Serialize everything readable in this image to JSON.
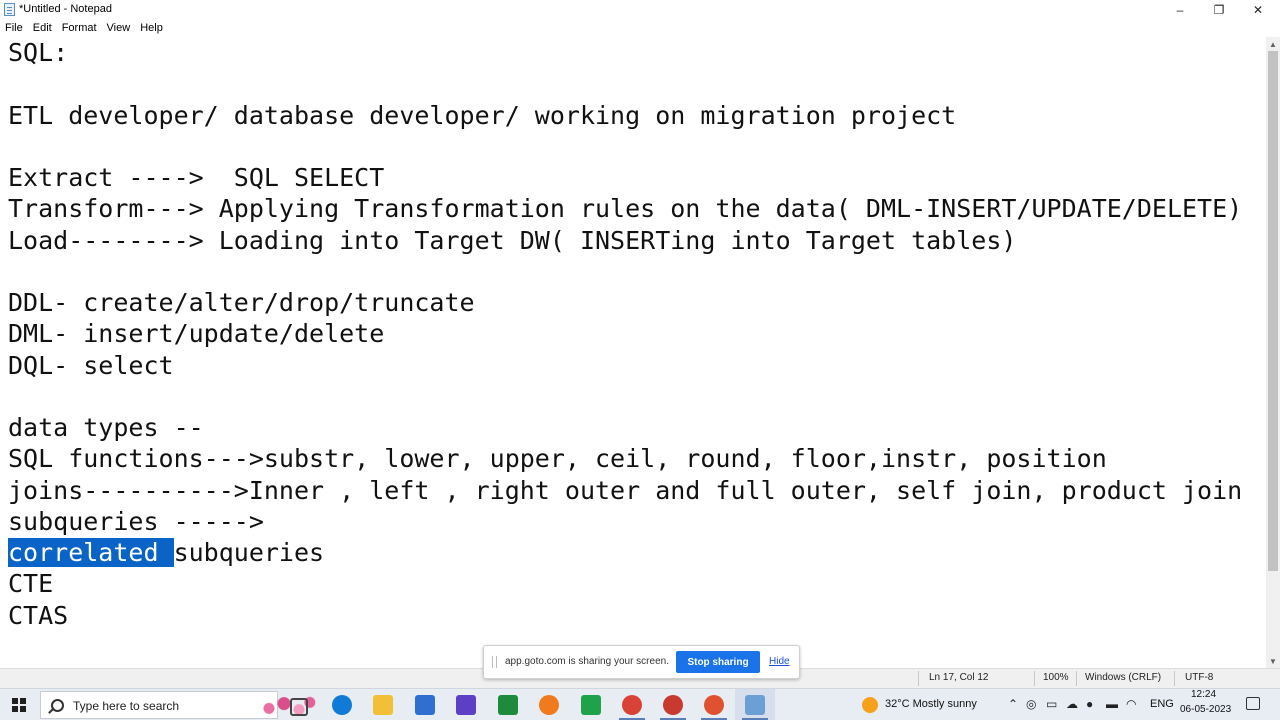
{
  "window": {
    "title": "*Untitled - Notepad",
    "controls": {
      "minimize": "–",
      "maximize": "❐",
      "close": "✕"
    }
  },
  "menu": [
    "File",
    "Edit",
    "Format",
    "View",
    "Help"
  ],
  "document": {
    "lines": [
      "SQL:",
      "",
      "ETL developer/ database developer/ working on migration project",
      "",
      "Extract ---->  SQL SELECT",
      "Transform---> Applying Transformation rules on the data( DML-INSERT/UPDATE/DELETE)",
      "Load--------> Loading into Target DW( INSERTing into Target tables)",
      "",
      "DDL- create/alter/drop/truncate",
      "DML- insert/update/delete",
      "DQL- select",
      "",
      "data types --",
      "SQL functions--->substr, lower, upper, ceil, round, floor,instr, position",
      "joins---------->Inner , left , right outer and full outer, self join, product join",
      "subqueries ----->"
    ],
    "selected_text": "correlated ",
    "after_selection": "subqueries",
    "lines_after": [
      "CTE",
      "CTAS"
    ]
  },
  "status_bar": {
    "position": "Ln 17, Col 12",
    "zoom": "100%",
    "line_ending": "Windows (CRLF)",
    "encoding": "UTF-8"
  },
  "share_banner": {
    "message": "app.goto.com is sharing your screen.",
    "stop_label": "Stop sharing",
    "hide_label": "Hide"
  },
  "taskbar": {
    "search_placeholder": "Type here to search",
    "weather": "32°C  Mostly sunny",
    "language": "ENG",
    "time": "12:24",
    "date": "06-05-2023",
    "apps": [
      {
        "icon": "task-view-icon",
        "color": "#444444"
      },
      {
        "icon": "edge-icon",
        "color": "#0f7bd6"
      },
      {
        "icon": "file-explorer-icon",
        "color": "#f2c037"
      },
      {
        "icon": "mail-icon",
        "color": "#2f6fd0"
      },
      {
        "icon": "visual-studio-icon",
        "color": "#5c3fc4"
      },
      {
        "icon": "xbox-icon",
        "color": "#1e8a3c"
      },
      {
        "icon": "settings-app-icon",
        "color": "#f07b1d"
      },
      {
        "icon": "app-icon",
        "color": "#1fa34a"
      },
      {
        "icon": "chrome-icon",
        "color": "#d94237"
      },
      {
        "icon": "chrome-profile-icon",
        "color": "#c83a30"
      },
      {
        "icon": "chrome-alt-icon",
        "color": "#e0522f"
      },
      {
        "icon": "notepad-icon",
        "color": "#6b9fd6"
      }
    ]
  }
}
